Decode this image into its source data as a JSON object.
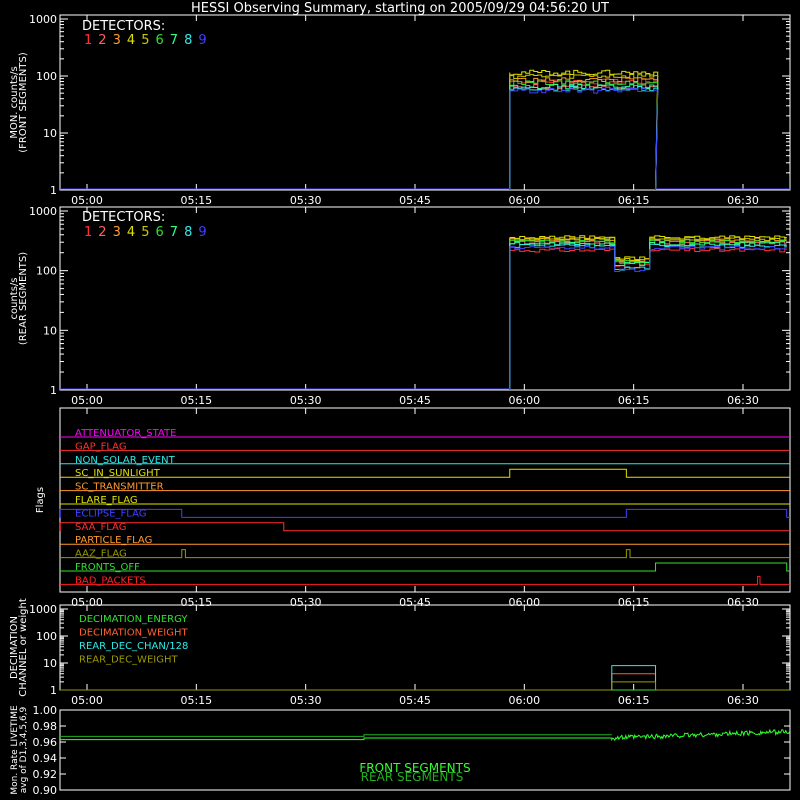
{
  "title": "HESSI Observing Summary, starting on 2005/09/29 04:56:20 UT",
  "colors": {
    "det": [
      "#ff3030",
      "#ff6060",
      "#ff9a30",
      "#e0e000",
      "#c8c800",
      "#30e030",
      "#30ff90",
      "#30e8e8",
      "#4040ff"
    ],
    "background": "#000000",
    "axis": "#ffffff"
  },
  "chart_data": [
    {
      "type": "line",
      "name": "front",
      "ylabel": [
        "MON. counts/s",
        "(FRONT SEGMENTS)"
      ],
      "yscale": "log",
      "ylim": [
        1,
        1000
      ],
      "yticks": [
        "1",
        "10",
        "100",
        "1000"
      ],
      "xlim": [
        "04:56:20",
        "06:36:00"
      ],
      "xticks": [
        "05:00",
        "05:15",
        "05:30",
        "05:45",
        "06:00",
        "06:15",
        "06:30"
      ],
      "legend_title": "DETECTORS:",
      "legend_labels": [
        "1",
        "2",
        "3",
        "4",
        "5",
        "6",
        "7",
        "8",
        "9"
      ],
      "data_window": [
        "05:58",
        "06:18"
      ],
      "series_levels": [
        80,
        65,
        85,
        115,
        100,
        75,
        65,
        60,
        55
      ]
    },
    {
      "type": "line",
      "name": "rear",
      "ylabel": [
        "counts/s",
        "(REAR SEGMENTS)"
      ],
      "yscale": "log",
      "ylim": [
        1,
        1000
      ],
      "yticks": [
        "1",
        "10",
        "100",
        "1000"
      ],
      "xlim": [
        "04:56:20",
        "06:36:00"
      ],
      "xticks": [
        "05:00",
        "05:15",
        "05:30",
        "05:45",
        "06:00",
        "06:15",
        "06:30"
      ],
      "legend_title": "DETECTORS:",
      "legend_labels": [
        "1",
        "2",
        "3",
        "4",
        "5",
        "6",
        "7",
        "8",
        "9"
      ],
      "data_window": [
        "05:58",
        "06:36"
      ],
      "dip_window": [
        "06:12",
        "06:17"
      ],
      "series_levels": [
        220,
        300,
        330,
        360,
        340,
        310,
        280,
        260,
        240
      ],
      "dip_levels": [
        120,
        140,
        150,
        160,
        150,
        140,
        130,
        110,
        100
      ]
    },
    {
      "type": "line",
      "name": "flags",
      "ylabel": "Flags",
      "xticks": [
        "05:00",
        "05:15",
        "05:30",
        "05:45",
        "06:00",
        "06:15",
        "06:30"
      ],
      "flags": [
        {
          "label": "ATTENUATOR_STATE",
          "color": "#ff00ff",
          "steps": []
        },
        {
          "label": "GAP_FLAG",
          "color": "#ff3030",
          "steps": [
            [
              "05:58",
              "06:36",
              0
            ]
          ]
        },
        {
          "label": "NON_SOLAR_EVENT",
          "color": "#30e8e8",
          "steps": []
        },
        {
          "label": "SC_IN_SUNLIGHT",
          "color": "#e0e000",
          "steps": [
            [
              "05:58",
              "06:14",
              1
            ]
          ]
        },
        {
          "label": "SC_TRANSMITTER",
          "color": "#ff9a30",
          "steps": []
        },
        {
          "label": "FLARE_FLAG",
          "color": "#e0e000",
          "steps": []
        },
        {
          "label": "ECLIPSE_FLAG",
          "color": "#4040ff",
          "steps": [
            [
              "04:56:20",
              "05:13",
              1
            ],
            [
              "06:14",
              "06:36",
              1
            ]
          ]
        },
        {
          "label": "SAA_FLAG",
          "color": "#ff3030",
          "steps": [
            [
              "04:56:20",
              "05:27",
              1
            ]
          ]
        },
        {
          "label": "PARTICLE_FLAG",
          "color": "#ff9a30",
          "steps": []
        },
        {
          "label": "AAZ_FLAG",
          "color": "#999900",
          "steps": [
            [
              "05:13",
              "05:13:30",
              1
            ],
            [
              "06:14",
              "06:14:30",
              1
            ]
          ]
        },
        {
          "label": "FRONTS_OFF",
          "color": "#30e030",
          "steps": [
            [
              "06:18",
              "06:36",
              1
            ]
          ]
        },
        {
          "label": "BAD_PACKETS",
          "color": "#ff2020",
          "steps": [
            [
              "06:32",
              "06:32:20",
              1
            ]
          ]
        }
      ]
    },
    {
      "type": "line",
      "name": "decimation",
      "ylabel": [
        "DECIMATION",
        "CHANNEL or weight"
      ],
      "yscale": "log",
      "ylim": [
        1,
        1000
      ],
      "yticks": [
        "1",
        "10",
        "100",
        "1000"
      ],
      "xticks": [
        "05:00",
        "05:15",
        "05:30",
        "05:45",
        "06:00",
        "06:15",
        "06:30"
      ],
      "legend_labels": [
        "DECIMATION_ENERGY",
        "DECIMATION_WEIGHT",
        "REAR_DEC_CHAN/128",
        "REAR_DEC_WEIGHT"
      ],
      "legend_colors": [
        "#30e030",
        "#ff6030",
        "#30e8e8",
        "#999900"
      ],
      "event_window": [
        "06:12",
        "06:18"
      ],
      "event_levels": [
        1,
        4,
        8,
        2
      ]
    },
    {
      "type": "line",
      "name": "livetime",
      "ylabel": [
        "Mon. Rate LIVETIME",
        "avg of D1,3,4,5,6,9"
      ],
      "ylim": [
        0.9,
        1.0
      ],
      "yticks": [
        "0.90",
        "0.92",
        "0.94",
        "0.96",
        "0.98",
        "1.00"
      ],
      "legend_labels": [
        "FRONT SEGMENTS",
        "REAR SEGMENTS"
      ],
      "legend_colors": [
        "#30ff30",
        "#20b020"
      ],
      "steps": [
        {
          "x0": "04:56:20",
          "x1": "05:38",
          "front": 0.963,
          "rear": 0.967
        },
        {
          "x0": "05:38",
          "x1": "06:12",
          "front": 0.965,
          "rear": 0.969
        },
        {
          "x0": "06:12",
          "x1": "06:36",
          "front_start": 0.965,
          "front_end": 0.973
        }
      ]
    }
  ]
}
